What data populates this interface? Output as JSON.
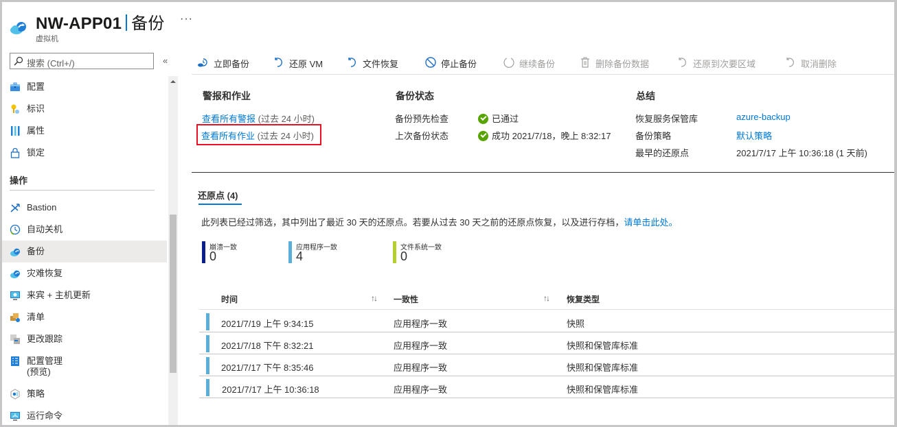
{
  "header": {
    "resource_name": "NW-APP01",
    "blade_name": "备份",
    "resource_type": "虚拟机",
    "more_label": "···"
  },
  "sidebar": {
    "search_placeholder": "搜索 (Ctrl+/)",
    "collapse_label": "«",
    "items": [
      {
        "label": "配置",
        "icon": "briefcase-icon"
      },
      {
        "label": "标识",
        "icon": "key-icon"
      },
      {
        "label": "属性",
        "icon": "properties-bars-icon"
      },
      {
        "label": "锁定",
        "icon": "lock-icon"
      }
    ],
    "group_operations": "操作",
    "operations": [
      {
        "label": "Bastion",
        "icon": "bastion-icon"
      },
      {
        "label": "自动关机",
        "icon": "clock-icon"
      },
      {
        "label": "备份",
        "icon": "backup-cloud-icon",
        "active": true
      },
      {
        "label": "灾难恢复",
        "icon": "disaster-recovery-cloud-icon"
      },
      {
        "label": "来宾 + 主机更新",
        "icon": "monitor-update-icon"
      },
      {
        "label": "清单",
        "icon": "inventory-box-icon"
      },
      {
        "label": "更改跟踪",
        "icon": "change-tracking-icon"
      },
      {
        "label": "配置管理",
        "label2": "(预览)",
        "icon": "config-management-icon"
      },
      {
        "label": "策略",
        "icon": "policy-icon"
      },
      {
        "label": "运行命令",
        "icon": "run-command-icon"
      }
    ]
  },
  "toolbar": {
    "buttons": [
      {
        "label": "立即备份",
        "icon": "backup-now-icon",
        "enabled": true
      },
      {
        "label": "还原 VM",
        "icon": "restore-icon",
        "enabled": true
      },
      {
        "label": "文件恢复",
        "icon": "file-recovery-icon",
        "enabled": true
      },
      {
        "label": "停止备份",
        "icon": "stop-icon",
        "enabled": true
      },
      {
        "label": "继续备份",
        "icon": "resume-icon",
        "enabled": false
      },
      {
        "label": "删除备份数据",
        "icon": "trash-icon",
        "enabled": false
      },
      {
        "label": "还原到次要区域",
        "icon": "restore-secondary-icon",
        "enabled": false
      },
      {
        "label": "取消删除",
        "icon": "undelete-icon",
        "enabled": false
      }
    ]
  },
  "alerts": {
    "title": "警报和作业",
    "alerts_link": "查看所有警报",
    "alerts_suffix": "(过去 24 小时)",
    "jobs_link": "查看所有作业",
    "jobs_suffix": "(过去 24 小时)"
  },
  "backup_status": {
    "title": "备份状态",
    "precheck_label": "备份预先检查",
    "precheck_value": "已通过",
    "last_backup_label": "上次备份状态",
    "last_backup_value": "成功 2021/7/18，晚上 8:32:17",
    "status_color": "#57a300"
  },
  "summary": {
    "title": "总结",
    "vault_label": "恢复服务保管库",
    "vault_value": "azure-backup",
    "policy_label": "备份策略",
    "policy_value": "默认策略",
    "oldest_label": "最早的还原点",
    "oldest_value": "2021/7/17 上午 10:36:18 (1 天前)"
  },
  "restore_points": {
    "tab_label": "还原点 (4)",
    "description": "此列表已经过筛选，其中列出了最近 30 天的还原点。若要从过去 30 天之前的还原点恢复，以及进行存档，",
    "description_link": "请单击此处。",
    "stats": [
      {
        "label": "崩溃一致",
        "value": "0",
        "color": "#0b1e8c"
      },
      {
        "label": "应用程序一致",
        "value": "4",
        "color": "#5aaed8"
      },
      {
        "label": "文件系统一致",
        "value": "0",
        "color": "#b6cf2d"
      }
    ],
    "columns": [
      "时间",
      "一致性",
      "恢复类型"
    ],
    "sort_glyph": "↑↓",
    "rows": [
      {
        "time": "2021/7/19 上午 9:34:15",
        "consistency": "应用程序一致",
        "type": "快照"
      },
      {
        "time": "2021/7/18 下午 8:32:21",
        "consistency": "应用程序一致",
        "type": "快照和保管库标准"
      },
      {
        "time": "2021/7/17 下午 8:35:46",
        "consistency": "应用程序一致",
        "type": "快照和保管库标准"
      },
      {
        "time": "2021/7/17 上午 10:36:18",
        "consistency": "应用程序一致",
        "type": "快照和保管库标准"
      }
    ]
  }
}
